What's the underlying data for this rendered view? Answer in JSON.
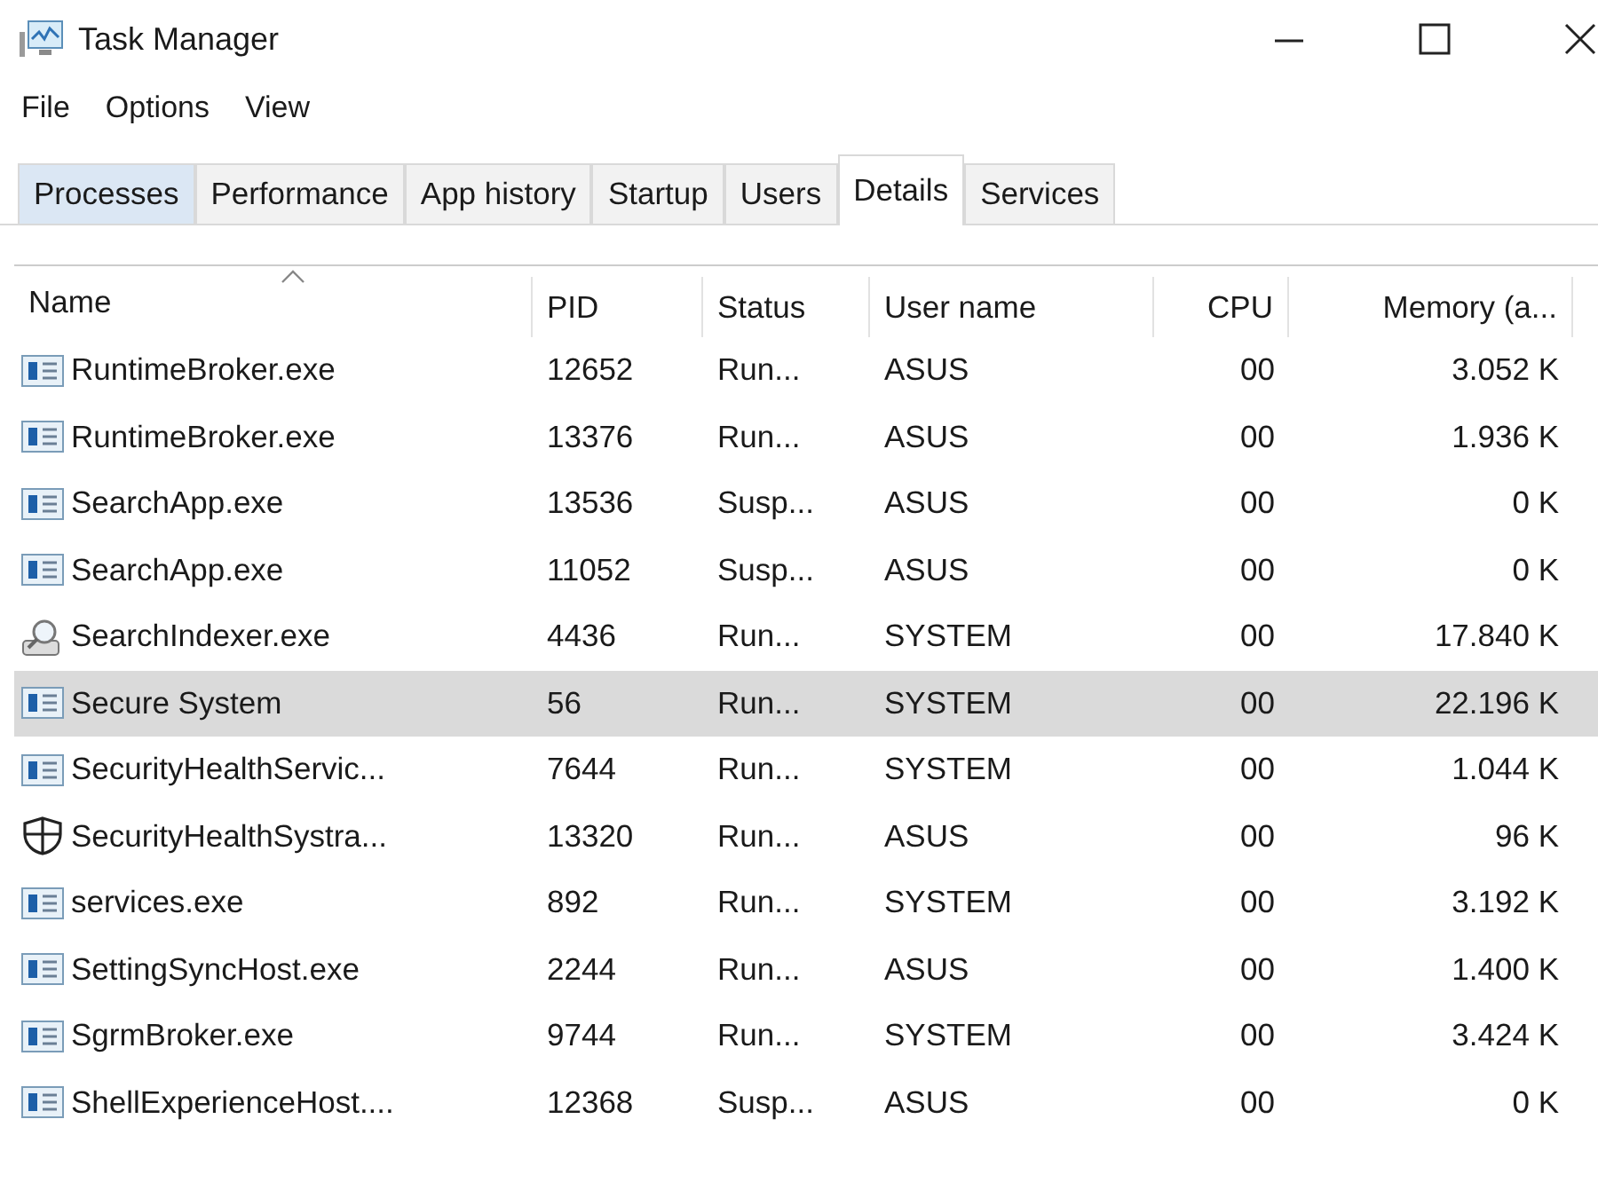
{
  "window": {
    "title": "Task Manager"
  },
  "menu": [
    "File",
    "Options",
    "View"
  ],
  "tabs": [
    {
      "label": "Processes",
      "selected": false
    },
    {
      "label": "Performance",
      "selected": false
    },
    {
      "label": "App history",
      "selected": false
    },
    {
      "label": "Startup",
      "selected": false
    },
    {
      "label": "Users",
      "selected": false
    },
    {
      "label": "Details",
      "selected": true
    },
    {
      "label": "Services",
      "selected": false
    }
  ],
  "table": {
    "columns": [
      "Name",
      "PID",
      "Status",
      "User name",
      "CPU",
      "Memory (a..."
    ],
    "rows": [
      {
        "kind": "app",
        "name": "RuntimeBroker.exe",
        "pid": "12652",
        "status": "Run...",
        "user": "ASUS",
        "cpu": "00",
        "memory": "3.052 K",
        "selected": false
      },
      {
        "kind": "app",
        "name": "RuntimeBroker.exe",
        "pid": "13376",
        "status": "Run...",
        "user": "ASUS",
        "cpu": "00",
        "memory": "1.936 K",
        "selected": false
      },
      {
        "kind": "app",
        "name": "SearchApp.exe",
        "pid": "13536",
        "status": "Susp...",
        "user": "ASUS",
        "cpu": "00",
        "memory": "0 K",
        "selected": false
      },
      {
        "kind": "app",
        "name": "SearchApp.exe",
        "pid": "11052",
        "status": "Susp...",
        "user": "ASUS",
        "cpu": "00",
        "memory": "0 K",
        "selected": false
      },
      {
        "kind": "indexer",
        "name": "SearchIndexer.exe",
        "pid": "4436",
        "status": "Run...",
        "user": "SYSTEM",
        "cpu": "00",
        "memory": "17.840 K",
        "selected": false
      },
      {
        "kind": "app",
        "name": "Secure System",
        "pid": "56",
        "status": "Run...",
        "user": "SYSTEM",
        "cpu": "00",
        "memory": "22.196 K",
        "selected": true
      },
      {
        "kind": "app",
        "name": "SecurityHealthServic...",
        "pid": "7644",
        "status": "Run...",
        "user": "SYSTEM",
        "cpu": "00",
        "memory": "1.044 K",
        "selected": false
      },
      {
        "kind": "shield",
        "name": "SecurityHealthSystra...",
        "pid": "13320",
        "status": "Run...",
        "user": "ASUS",
        "cpu": "00",
        "memory": "96 K",
        "selected": false
      },
      {
        "kind": "app",
        "name": "services.exe",
        "pid": "892",
        "status": "Run...",
        "user": "SYSTEM",
        "cpu": "00",
        "memory": "3.192 K",
        "selected": false
      },
      {
        "kind": "app",
        "name": "SettingSyncHost.exe",
        "pid": "2244",
        "status": "Run...",
        "user": "ASUS",
        "cpu": "00",
        "memory": "1.400 K",
        "selected": false
      },
      {
        "kind": "app",
        "name": "SgrmBroker.exe",
        "pid": "9744",
        "status": "Run...",
        "user": "SYSTEM",
        "cpu": "00",
        "memory": "3.424 K",
        "selected": false
      },
      {
        "kind": "app",
        "name": "ShellExperienceHost....",
        "pid": "12368",
        "status": "Susp...",
        "user": "ASUS",
        "cpu": "00",
        "memory": "0 K",
        "selected": false
      }
    ]
  }
}
